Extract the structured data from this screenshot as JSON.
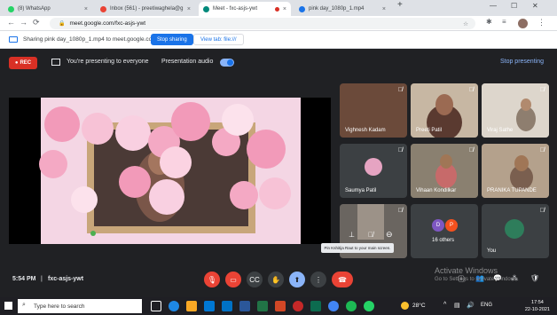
{
  "browser": {
    "tabs": [
      {
        "title": "(8) WhatsApp",
        "color": "#25d366"
      },
      {
        "title": "Inbox (561) - preetiwaghela@g",
        "color": "#ea4335"
      },
      {
        "title": "Meet - fxc-asjs-ywt",
        "color": "#00897b"
      },
      {
        "title": "pink day_1080p_1.mp4",
        "color": "#1a73e8"
      }
    ],
    "new_tab": "+",
    "url": "meet.google.com/fxc-asjs-ywt"
  },
  "share_bar": {
    "message": "Sharing pink day_1080p_1.mp4 to meet.google.com",
    "stop_label": "Stop sharing",
    "view_label": "View tab: file:///"
  },
  "meet": {
    "rec": "REC",
    "presenting": "You're presenting to everyone",
    "presentation_audio": "Presentation audio",
    "stop_presenting": "Stop presenting",
    "participants": [
      {
        "name": "Vighnesh Kadam",
        "bg": "#6b4a3a"
      },
      {
        "name": "Preeti Patil",
        "bg": "#7a5a44"
      },
      {
        "name": "Viraj Sathe",
        "bg": "#c9c3bb"
      },
      {
        "name": "Saumya Patil",
        "bg": "#3c4043"
      },
      {
        "name": "Vihaan Kondilkar",
        "bg": "#6f6a5d"
      },
      {
        "name": "PRANIKA TUPANDE",
        "bg": "#8a7462"
      },
      {
        "name": "",
        "bg": "#3c4043"
      },
      {
        "name": "16 others",
        "bg": "#3c4043"
      },
      {
        "name": "You",
        "bg": "#3c4043"
      }
    ],
    "others_avatars": [
      "D",
      "P"
    ],
    "tooltip": "Pin Kshitija Raut to your main screen.",
    "time": "5:54 PM",
    "separator": "|",
    "meeting_code": "fxc-asjs-ywt"
  },
  "activate": {
    "title": "Activate Windows",
    "sub": "Go to Settings to activate Windows."
  },
  "taskbar": {
    "search_placeholder": "Type here to search",
    "weather": "28°C",
    "lang": "ENG",
    "time": "17:54",
    "date": "22-10-2021"
  }
}
